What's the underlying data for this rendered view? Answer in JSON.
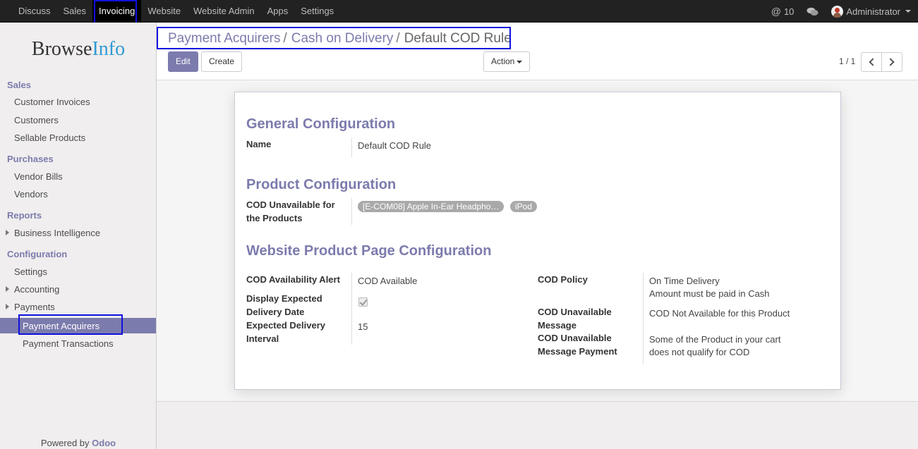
{
  "topbar": {
    "menu": [
      "Discuss",
      "Sales",
      "Invoicing",
      "Website",
      "Website Admin",
      "Apps",
      "Settings"
    ],
    "active_menu": "Invoicing",
    "messages_count": "10",
    "user": "Administrator"
  },
  "sidebar": {
    "logo_browse": "Browse",
    "logo_info": "Info",
    "sections": {
      "sales": {
        "title": "Sales",
        "items": [
          "Customer Invoices",
          "Customers",
          "Sellable Products"
        ]
      },
      "purchases": {
        "title": "Purchases",
        "items": [
          "Vendor Bills",
          "Vendors"
        ]
      },
      "reports": {
        "title": "Reports",
        "items": [
          "Business Intelligence"
        ]
      },
      "configuration": {
        "title": "Configuration",
        "items": [
          "Settings",
          "Accounting",
          "Payments",
          "Payment Acquirers",
          "Payment Transactions"
        ]
      }
    },
    "powered_by": "Powered by",
    "powered_brand": "Odoo"
  },
  "breadcrumb": {
    "items": [
      "Payment Acquirers",
      "Cash on Delivery"
    ],
    "separator": "/",
    "current": "Default COD Rule"
  },
  "toolbar": {
    "edit": "Edit",
    "create": "Create",
    "action": "Action",
    "pager": "1 / 1"
  },
  "form": {
    "general": {
      "title": "General Configuration",
      "name_label": "Name",
      "name_value": "Default COD Rule"
    },
    "product": {
      "title": "Product Configuration",
      "unavailable_label_1": "COD Unavailable for",
      "unavailable_label_2": "the Products",
      "tags": [
        "[E-COM08] Apple In-Ear Headpho…",
        "iPod"
      ]
    },
    "website": {
      "title": "Website Product Page Configuration",
      "alert_label": "COD Availability Alert",
      "alert_value": "COD Available",
      "display_date_label_1": "Display Expected",
      "display_date_label_2": "Delivery Date",
      "display_date_checked": true,
      "interval_label_1": "Expected Delivery",
      "interval_label_2": "Interval",
      "interval_value": "15",
      "policy_label": "COD Policy",
      "policy_value_1": "On Time Delivery",
      "policy_value_2": "Amount must be paid in Cash",
      "unavail_msg_label_1": "COD Unavailable",
      "unavail_msg_label_2": "Message",
      "unavail_msg_value": "COD Not Available for this Product",
      "unavail_pay_label_1": "COD Unavailable",
      "unavail_pay_label_2": "Message Payment",
      "unavail_pay_value_1": "Some of the Product in your cart",
      "unavail_pay_value_2": "does not qualify for COD"
    }
  },
  "colors": {
    "accent": "#7c7bad",
    "topbar": "#222222",
    "highlight": "#1010e0"
  }
}
